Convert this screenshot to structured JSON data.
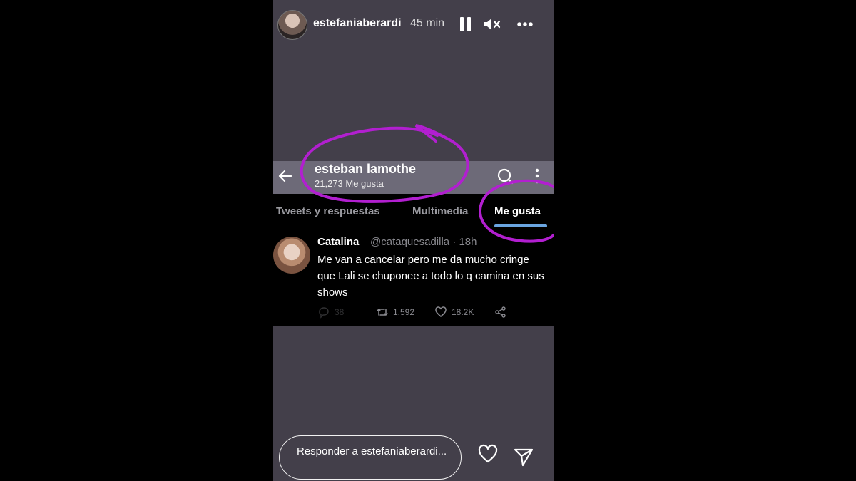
{
  "story": {
    "username": "estefaniaberardi",
    "time": "45 min",
    "reply_placeholder": "Responder a estefaniaberardi..."
  },
  "twitter": {
    "profile_name": "esteban lamothe",
    "likes_count": "21,273 Me gusta",
    "tabs": [
      {
        "label": "Tweets y respuestas",
        "active": false
      },
      {
        "label": "Multimedia",
        "active": false
      },
      {
        "label": "Me gusta",
        "active": true
      }
    ],
    "tweet": {
      "name": "Catalina",
      "handle": "@cataquesadilla · 18h",
      "text": "Me van a cancelar pero me da mucho cringe que Lali se chuponee a todo lo q camina en sus shows",
      "replies": "38",
      "retweets": "1,592",
      "likes": "18.2K"
    }
  },
  "colors": {
    "story_bg": "#433f4a",
    "twitter_bar": "#6d6a78",
    "annotation": "#b21fd0",
    "tab_underline": "#6aa5e0"
  }
}
